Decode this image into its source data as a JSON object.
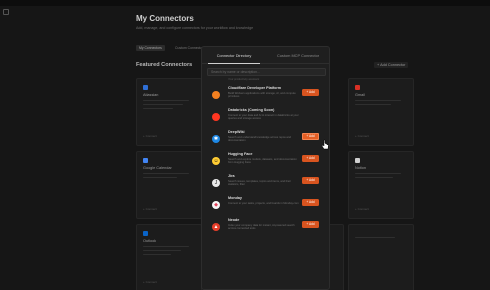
{
  "page": {
    "title": "My Connectors",
    "subtitle": "Add, manage, and configure connectors for your workflow and knowledge",
    "tabs": [
      "My Connectors",
      "Custom Connectors"
    ],
    "featured_heading": "Featured Connectors",
    "add_connector_label": "+ Add Connector",
    "cards": [
      {
        "title": "Atlassian",
        "foot": "+ Connect"
      },
      {
        "title": "Gmail",
        "foot": "+ Connect"
      },
      {
        "title": "Google Calendar",
        "foot": "+ Connect"
      },
      {
        "title": "Notion",
        "foot": "+ Connect"
      },
      {
        "title": "Outlook",
        "foot": "+ Connect"
      }
    ]
  },
  "modal": {
    "tabs": [
      "Connector Directory",
      "Custom MCP Connector"
    ],
    "search_placeholder": "Search by name or description...",
    "partial_top_text": "Your productivity assistant",
    "items": [
      {
        "name": "Cloudflare Developer Platform",
        "description": "Build Workers applications with storage, AI, and compute primitives",
        "add_label": "+ Add",
        "icon": "cloudflare-icon"
      },
      {
        "name": "Databricks (Coming Soon)",
        "description": "Connect to your data and AI to interact in databricks at your queries and storage access",
        "add_label": "+ Add",
        "icon": "databricks-icon"
      },
      {
        "name": "DeepWiki",
        "description": "Search and understand knowledge across repos and documentation",
        "add_label": "+ Add",
        "icon": "deepwiki-icon"
      },
      {
        "name": "Hugging Face",
        "description": "Search and explore models, datasets, and documentation from Hugging Face",
        "add_label": "+ Add",
        "icon": "hugging-face-icon"
      },
      {
        "name": "Jira",
        "description": "Search issues, templates, topics and items, and their statistics, filter",
        "add_label": "+ Add",
        "icon": "jira-icon"
      },
      {
        "name": "Monday",
        "description": "Connect to your tasks, projects, and boards in Monday.com",
        "add_label": "+ Add",
        "icon": "monday-icon"
      },
      {
        "name": "Neode",
        "description": "Index your company data for instant, AI-powered search across connected tools",
        "add_label": "+ Add",
        "icon": "neode-icon"
      }
    ]
  }
}
